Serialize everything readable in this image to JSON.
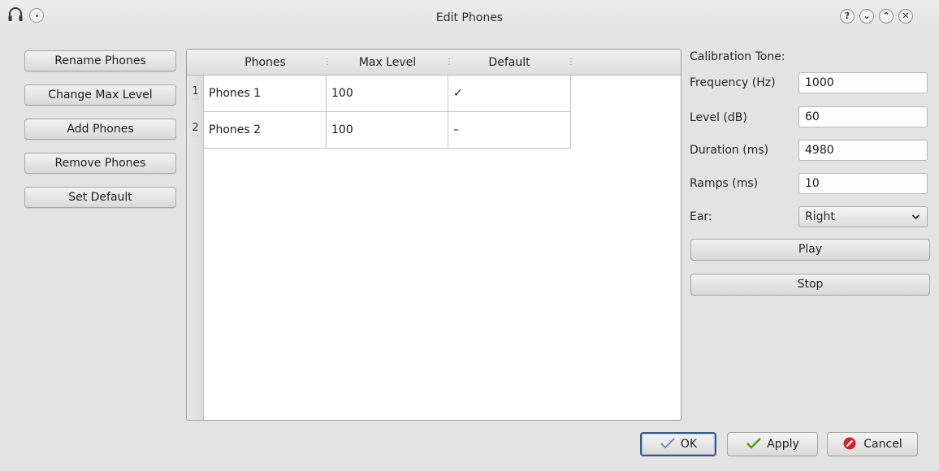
{
  "window": {
    "title": "Edit Phones",
    "controls": [
      "help-icon",
      "minimize-icon",
      "maximize-icon",
      "close-icon"
    ],
    "control_glyphs": {
      "help": "?",
      "minimize": "⌄",
      "maximize": "⌃",
      "close": "✕"
    }
  },
  "left_buttons": {
    "rename": "Rename Phones",
    "change_max": "Change Max Level",
    "add": "Add Phones",
    "remove": "Remove Phones",
    "set_default": "Set Default"
  },
  "table": {
    "columns": [
      "Phones",
      "Max Level",
      "Default"
    ],
    "rows": [
      {
        "num": "1",
        "phones": "Phones 1",
        "max_level": "100",
        "default": "✓"
      },
      {
        "num": "2",
        "phones": "Phones 2",
        "max_level": "100",
        "default": "–"
      }
    ]
  },
  "calibration": {
    "heading": "Calibration Tone:",
    "frequency_label": "Frequency (Hz)",
    "frequency_value": "1000",
    "level_label": "Level (dB)",
    "level_value": "60",
    "duration_label": "Duration (ms)",
    "duration_value": "4980",
    "ramps_label": "Ramps (ms)",
    "ramps_value": "10",
    "ear_label": "Ear:",
    "ear_value": "Right",
    "play": "Play",
    "stop": "Stop"
  },
  "footer": {
    "ok": "OK",
    "apply": "Apply",
    "cancel": "Cancel"
  },
  "colors": {
    "accent_focus": "#3b5a82",
    "apply_check": "#4f9a1a",
    "cancel_red": "#d2232a"
  }
}
